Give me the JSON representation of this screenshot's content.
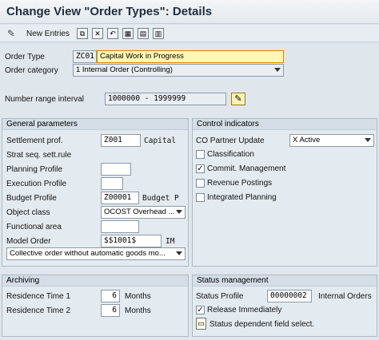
{
  "window": {
    "title": "Change View \"Order Types\": Details"
  },
  "toolbar": {
    "new_entries": "New Entries"
  },
  "header": {
    "order_type_label": "Order Type",
    "order_type_code": "ZC01",
    "order_type_desc": "Capital Work in Progress",
    "order_category_label": "Order category",
    "order_category_value": "1 Internal Order (Controlling)",
    "number_range_label": "Number range interval",
    "number_range_value": "1000000 - 1999999"
  },
  "general": {
    "title": "General parameters",
    "settlement_label": "Settlement prof.",
    "settlement_value": "Z001",
    "settlement_desc": "Capital",
    "strat_seq_label": "Strat seq. sett.rule",
    "planning_profile_label": "Planning Profile",
    "planning_profile_value": "",
    "execution_profile_label": "Execution Profile",
    "execution_profile_value": "",
    "budget_profile_label": "Budget Profile",
    "budget_profile_value": "Z00001",
    "budget_profile_desc": "Budget P",
    "object_class_label": "Object class",
    "object_class_value": "OCOST Overhead ...",
    "functional_area_label": "Functional area",
    "functional_area_value": "",
    "model_order_label": "Model Order",
    "model_order_value": "$$1001$",
    "model_order_desc": "IM",
    "collective_value": "Collective order without automatic goods mo..."
  },
  "control": {
    "title": "Control indicators",
    "co_partner_label": "CO Partner Update",
    "co_partner_value": "X Active",
    "classification": "Classification",
    "commit_mgmt": "Commit. Management",
    "revenue_postings": "Revenue Postings",
    "integrated_planning": "Integrated Planning",
    "checked": {
      "classification": false,
      "commit_mgmt": true,
      "revenue_postings": false,
      "integrated_planning": false
    }
  },
  "archiving": {
    "title": "Archiving",
    "residence1_label": "Residence Time 1",
    "residence1_value": "6",
    "residence2_label": "Residence Time 2",
    "residence2_value": "6",
    "unit": "Months"
  },
  "status": {
    "title": "Status management",
    "profile_label": "Status Profile",
    "profile_value": "00000002",
    "profile_desc": "Internal Orders",
    "release_label": "Release Immediately",
    "release_checked": true,
    "field_select_label": "Status dependent field select."
  }
}
